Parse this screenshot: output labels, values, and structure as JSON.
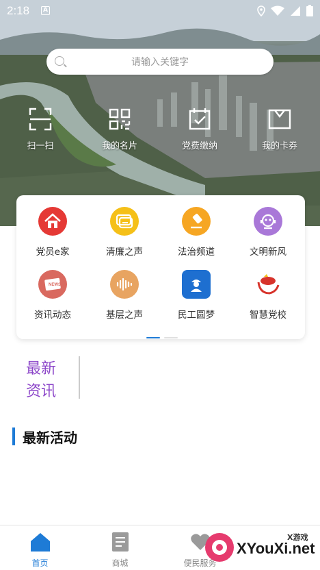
{
  "status_bar": {
    "time": "2:18",
    "notification_glyph": "A"
  },
  "search": {
    "placeholder": "请输入关键字"
  },
  "quick_actions": [
    {
      "label": "扫一扫",
      "icon": "scan-icon"
    },
    {
      "label": "我的名片",
      "icon": "qrcode-icon"
    },
    {
      "label": "党费缴纳",
      "icon": "calendar-check-icon"
    },
    {
      "label": "我的卡券",
      "icon": "coupon-icon"
    }
  ],
  "services": [
    {
      "label": "党员e家",
      "icon": "home-icon",
      "color": "#e53935"
    },
    {
      "label": "清廉之声",
      "icon": "message-icon",
      "color": "#f5c018"
    },
    {
      "label": "法治频道",
      "icon": "gavel-icon",
      "color": "#f6a623"
    },
    {
      "label": "文明新风",
      "icon": "robot-icon",
      "color": "#a978d8"
    },
    {
      "label": "资讯动态",
      "icon": "news-icon",
      "color": "#d9695f"
    },
    {
      "label": "基层之声",
      "icon": "soundwave-icon",
      "color": "#e8a461"
    },
    {
      "label": "民工圆梦",
      "icon": "worker-icon",
      "color": "#1e6fd0"
    },
    {
      "label": "智慧党校",
      "icon": "party-school-icon",
      "color": "#d7332b"
    }
  ],
  "news": {
    "label_line1": "最新",
    "label_line2": "资讯"
  },
  "activities": {
    "title": "最新活动"
  },
  "bottom_nav": [
    {
      "label": "首页",
      "icon": "home-nav-icon",
      "active": true
    },
    {
      "label": "商城",
      "icon": "shop-icon",
      "active": false
    },
    {
      "label": "便民服务",
      "icon": "heart-icon",
      "active": false
    }
  ],
  "watermark": {
    "text": "XYouXi.net",
    "small": "X游戏"
  },
  "colors": {
    "accent": "#1e7bd6",
    "news_purple": "#8c46c9"
  }
}
